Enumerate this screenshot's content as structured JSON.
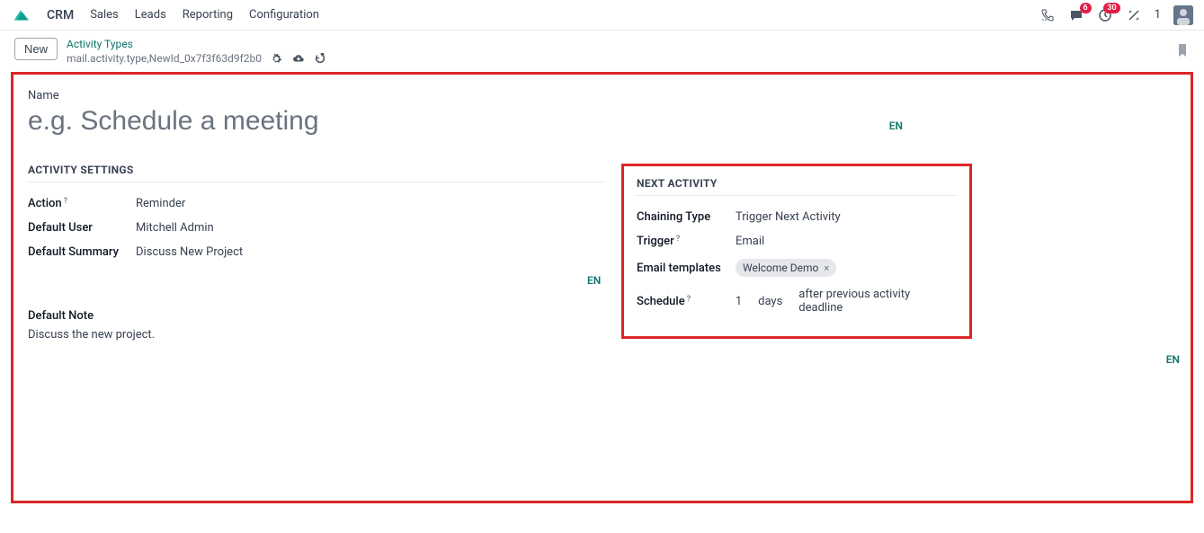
{
  "nav": {
    "brand": "CRM",
    "items": [
      "Sales",
      "Leads",
      "Reporting",
      "Configuration"
    ],
    "badges": {
      "chat": "6",
      "clock": "30"
    },
    "count": "1"
  },
  "subheader": {
    "new_label": "New",
    "breadcrumb": "Activity Types",
    "record_id": "mail.activity.type,NewId_0x7f3f63d9f2b0"
  },
  "form": {
    "name_label": "Name",
    "name_placeholder": "e.g. Schedule a meeting",
    "lang": "EN",
    "activity_settings_title": "ACTIVITY SETTINGS",
    "action_label": "Action",
    "action_value": "Reminder",
    "default_user_label": "Default User",
    "default_user_value": "Mitchell Admin",
    "default_summary_label": "Default Summary",
    "default_summary_value": "Discuss New Project",
    "default_note_label": "Default Note",
    "default_note_value": "Discuss the new project.",
    "next_activity_title": "NEXT ACTIVITY",
    "chaining_type_label": "Chaining Type",
    "chaining_type_value": "Trigger Next Activity",
    "trigger_label": "Trigger",
    "trigger_value": "Email",
    "email_templates_label": "Email templates",
    "email_template_chip": "Welcome Demo",
    "schedule_label": "Schedule",
    "schedule_count": "1",
    "schedule_unit": "days",
    "schedule_after": "after previous activity deadline"
  }
}
